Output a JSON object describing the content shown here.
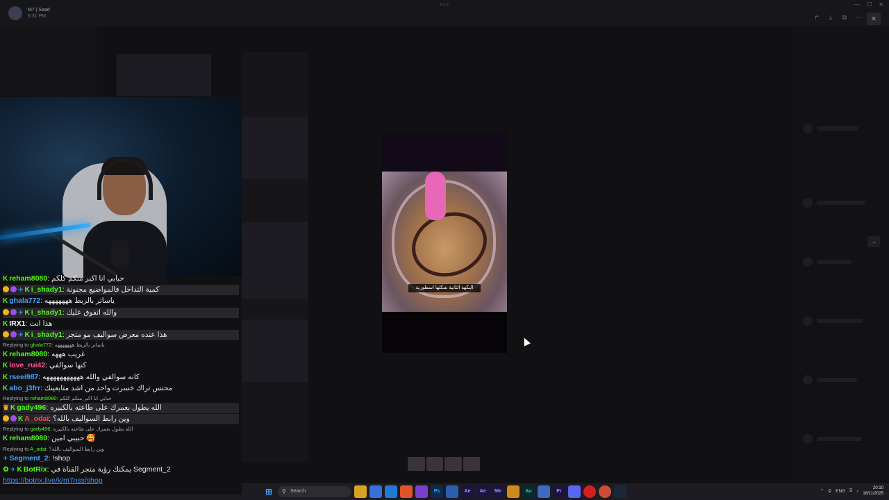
{
  "window": {
    "user_name": "M7 | Saad",
    "user_time": "6:31 PM",
    "center_title": "Kick"
  },
  "chat": {
    "messages": [
      {
        "user": "reham8080",
        "user_color": "#53fc18",
        "text": "حبابي انا اكبر منكم كلكم",
        "badges": [
          "kick"
        ]
      },
      {
        "user": "i_shady1",
        "user_color": "#53fc18",
        "text": "كمية التداخل فالمواضيع مجنونة",
        "badges": [
          "vip",
          "sub",
          "mod",
          "kick"
        ]
      },
      {
        "user": "ghala772",
        "user_color": "#3ea6ff",
        "text": "ياساتر بالربط هههههههه",
        "badges": [
          "kick"
        ]
      },
      {
        "user": "i_shady1",
        "user_color": "#53fc18",
        "text": "والله اتفوق عليك",
        "badges": [
          "vip",
          "sub",
          "mod",
          "kick"
        ]
      },
      {
        "user": "IRX1",
        "user_color": "#ffffff",
        "text": "هذا انت",
        "badges": [
          "kick"
        ]
      },
      {
        "user": "i_shady1",
        "user_color": "#53fc18",
        "text": "هذا عنده معرض سواليف مو متجر",
        "badges": [
          "vip",
          "sub",
          "mod",
          "kick"
        ]
      },
      {
        "user": "reham8080",
        "user_color": "#53fc18",
        "text": "غريب هههه",
        "badges": [
          "kick"
        ],
        "reply_to_user": "ghala772",
        "reply_text": "ياساتر بالربط هههههههه"
      },
      {
        "user": "love_rui42",
        "user_color": "#ff5a9c",
        "text": "كنها سوالفي",
        "badges": [
          "kick"
        ]
      },
      {
        "user": "rseei987",
        "user_color": "#3ea6ff",
        "text": "كانه سوالفي والله هههههههههههه",
        "badges": [
          "kick"
        ]
      },
      {
        "user": "abo_j3frr",
        "user_color": "#3ea6ff",
        "text": "محنس تراك خسرت واحد من اشد متابعينك",
        "badges": [
          "kick"
        ]
      },
      {
        "user": "gady496",
        "user_color": "#53fc18",
        "text": "الله يطول بعمرك على طاعته بالكبيره",
        "badges": [
          "crown",
          "kick"
        ],
        "reply_to_user": "reham8080",
        "reply_text": "حبابي انا اكبر منكم كلكم"
      },
      {
        "user": "A_odai",
        "user_color": "#ff4a4a",
        "text": "وين رابط السواليف بالله؟",
        "badges": [
          "vip",
          "sub",
          "kick"
        ]
      },
      {
        "user": "reham8080",
        "user_color": "#53fc18",
        "text": "حبيبي امين 🥰",
        "badges": [
          "kick"
        ],
        "reply_to_user": "gady496",
        "reply_text": "الله يطول بعمرك على طاعته بالكبيره"
      },
      {
        "user": "Segment_2",
        "user_color": "#3ea6ff",
        "text": "!shop",
        "badges": [
          "mod"
        ],
        "reply_to_user": "A_odai",
        "reply_text": "وين رابط السواليف بالله؟"
      },
      {
        "user": "BotRix",
        "user_color": "#53fc18",
        "text": "يمكنك رؤية متجر القناة في Segment_2",
        "badges": [
          "bot",
          "mod",
          "kick"
        ]
      }
    ],
    "replying_label": "Replying to",
    "link_text": "https://botrix.live/k/m7nss/shop"
  },
  "video": {
    "caption": "النكهة الثانية شكلها اسطورية"
  },
  "taskbar": {
    "search_placeholder": "Search",
    "lang": "ENG",
    "time": "20:10",
    "date": "16/11/2025",
    "apps": [
      "windows",
      "explorer",
      "store",
      "vscode",
      "brave",
      "vs",
      "ps",
      "app",
      "ae",
      "ae2",
      "me",
      "app2",
      "au",
      "app3",
      "pr",
      "discord",
      "opera",
      "chrome",
      "steam"
    ]
  },
  "colors": {
    "kick_green": "#53fc18",
    "link_blue": "#4a8ef5",
    "vip_gold": "#f3b21a"
  }
}
